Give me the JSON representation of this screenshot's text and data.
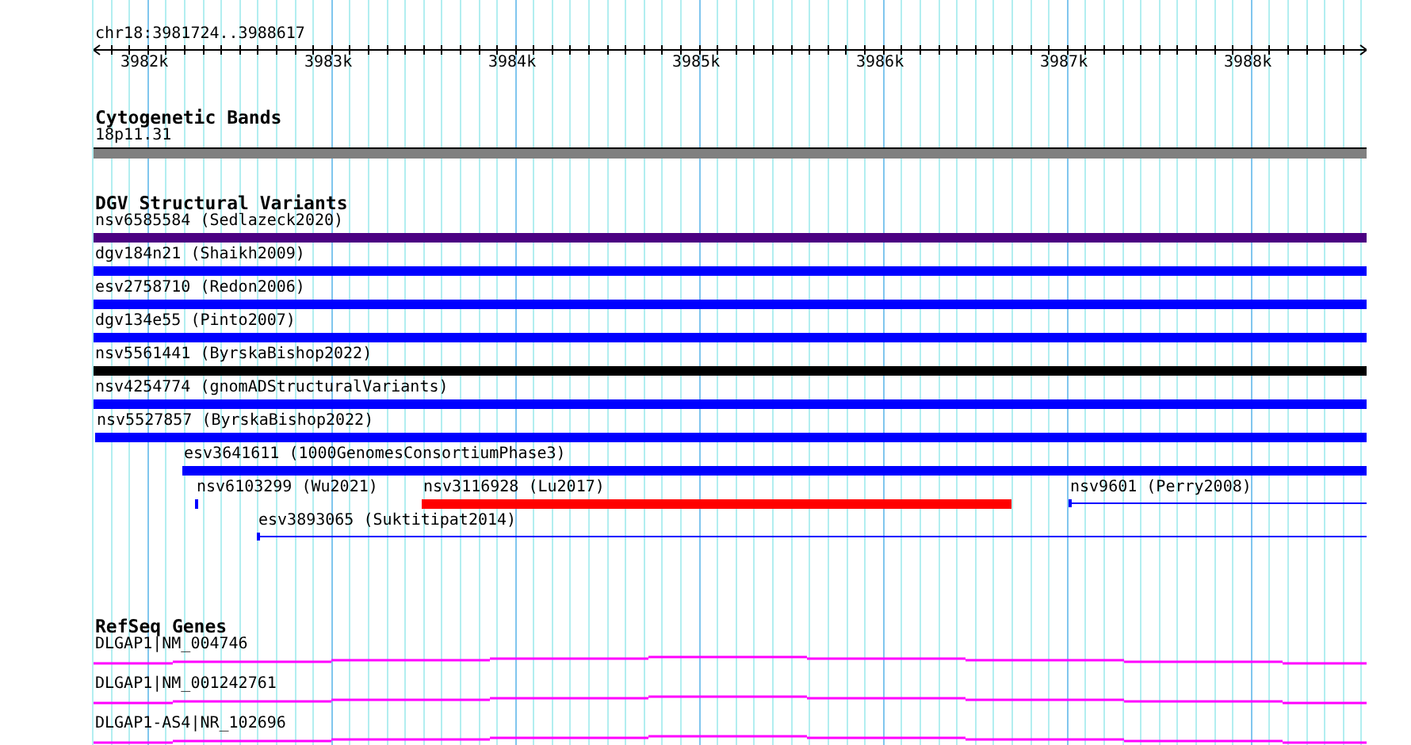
{
  "ruler": {
    "location": "chr18:3981724..3988617",
    "ticks": [
      "3982k",
      "3983k",
      "3984k",
      "3985k",
      "3986k",
      "3987k",
      "3988k"
    ]
  },
  "cytoband_track": {
    "title": "Cytogenetic Bands",
    "band": "18p11.31"
  },
  "dgv_track": {
    "title": "DGV Structural Variants",
    "rows": [
      {
        "features": [
          {
            "label": "nsv6585584 (Sedlazeck2020)",
            "kind": "bar",
            "color": "#4b0082"
          }
        ]
      },
      {
        "features": [
          {
            "label": "dgv184n21 (Shaikh2009)",
            "kind": "bar",
            "color": "#0000ff"
          }
        ]
      },
      {
        "features": [
          {
            "label": "esv2758710 (Redon2006)",
            "kind": "bar",
            "color": "#0000ff"
          }
        ]
      },
      {
        "features": [
          {
            "label": "dgv134e55 (Pinto2007)",
            "kind": "bar",
            "color": "#0000ff"
          }
        ]
      },
      {
        "features": [
          {
            "label": "nsv5561441 (ByrskaBishop2022)",
            "kind": "bar",
            "color": "#000000"
          }
        ]
      },
      {
        "features": [
          {
            "label": "nsv4254774 (gnomADStructuralVariants)",
            "kind": "bar",
            "color": "#0000ff"
          }
        ]
      },
      {
        "features": [
          {
            "label": "nsv5527857 (ByrskaBishop2022)",
            "kind": "bar",
            "color": "#0000ff"
          }
        ]
      },
      {
        "features": [
          {
            "label": "esv3641611 (1000GenomesConsortiumPhase3)",
            "kind": "bar",
            "color": "#0000ff"
          }
        ]
      },
      {
        "features": [
          {
            "label": "nsv6103299 (Wu2021)",
            "kind": "bar",
            "color": "#0000ff"
          },
          {
            "label": "nsv3116928 (Lu2017)",
            "kind": "bar",
            "color": "#ff0000"
          },
          {
            "label": "nsv9601 (Perry2008)",
            "kind": "line",
            "color": "#0000ff"
          }
        ]
      },
      {
        "features": [
          {
            "label": "esv3893065 (Suktitipat2014)",
            "kind": "line",
            "color": "#0000ff"
          }
        ]
      }
    ]
  },
  "refseq_track": {
    "title": "RefSeq Genes",
    "genes": [
      "DLGAP1|NM_004746",
      "DLGAP1|NM_001242761",
      "DLGAP1-AS4|NR_102696"
    ]
  }
}
